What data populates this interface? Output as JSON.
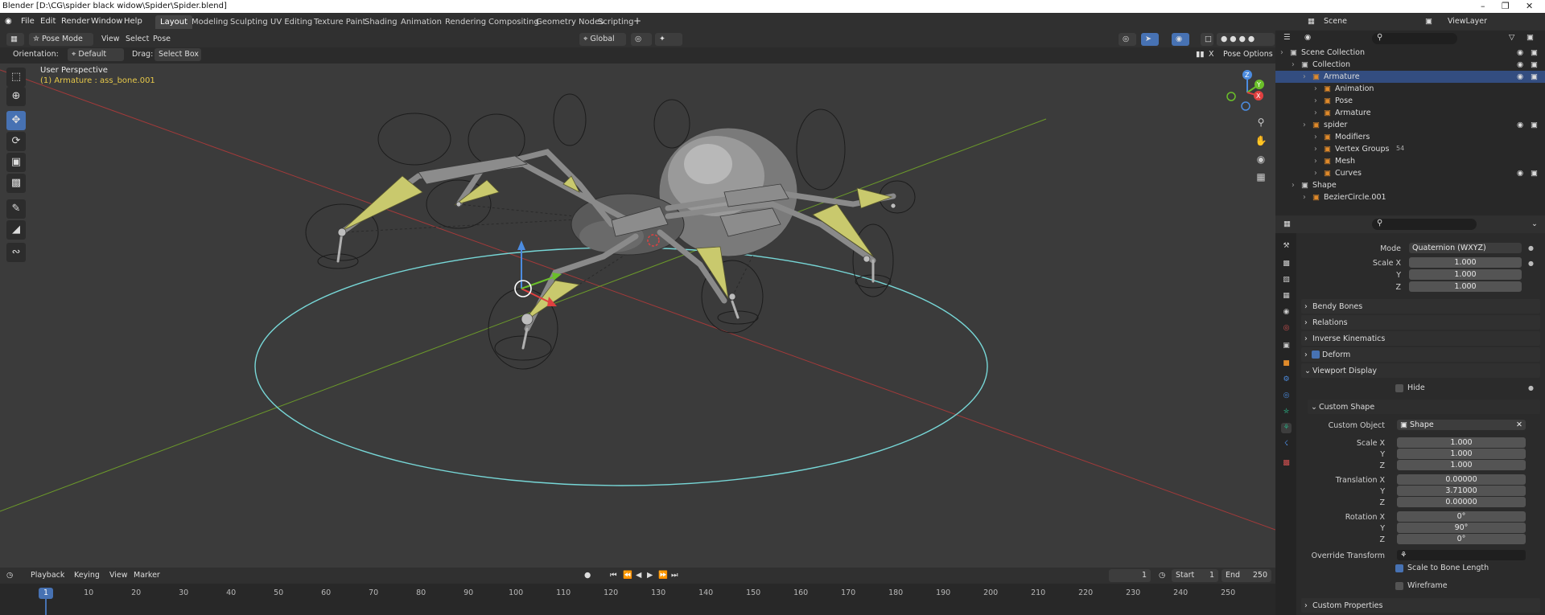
{
  "window": {
    "title": "Blender [D:\\CG\\spider black widow\\Spider\\Spider.blend]"
  },
  "menu": [
    "File",
    "Edit",
    "Render",
    "Window",
    "Help"
  ],
  "workspaces": [
    "Layout",
    "Modeling",
    "Sculpting",
    "UV Editing",
    "Texture Paint",
    "Shading",
    "Animation",
    "Rendering",
    "Compositing",
    "Geometry Nodes",
    "Scripting"
  ],
  "scene": {
    "name": "Scene",
    "view_layer": "ViewLayer"
  },
  "viewport_header": {
    "mode": "Pose Mode",
    "menus": [
      "View",
      "Select",
      "Pose"
    ],
    "transform_orientation": "Global",
    "orientation_label": "Orientation:",
    "orientation_value": "Default",
    "drag_label": "Drag:",
    "drag_value": "Select Box",
    "pose_options": "Pose Options"
  },
  "viewport": {
    "perspective": "User Perspective",
    "active_object": "(1) Armature : ass_bone.001",
    "gizmo_axes": [
      "X",
      "Y",
      "Z"
    ]
  },
  "timeline": {
    "menus": [
      "Playback",
      "Keying",
      "View",
      "Marker"
    ],
    "current_frame": "1",
    "start_label": "Start",
    "start": "1",
    "end_label": "End",
    "end": "250",
    "ticks": [
      "1",
      "10",
      "20",
      "30",
      "40",
      "50",
      "60",
      "70",
      "80",
      "90",
      "100",
      "110",
      "120",
      "130",
      "140",
      "150",
      "160",
      "170",
      "180",
      "190",
      "200",
      "210",
      "220",
      "230",
      "240",
      "250"
    ]
  },
  "outliner": {
    "items": [
      {
        "label": "Scene Collection",
        "indent": 0
      },
      {
        "label": "Collection",
        "indent": 1
      },
      {
        "label": "Armature",
        "indent": 2,
        "selected": true
      },
      {
        "label": "Animation",
        "indent": 3
      },
      {
        "label": "Pose",
        "indent": 3
      },
      {
        "label": "Armature",
        "indent": 3
      },
      {
        "label": "spider",
        "indent": 2
      },
      {
        "label": "Modifiers",
        "indent": 3
      },
      {
        "label": "Vertex Groups",
        "indent": 3
      },
      {
        "label": "Mesh",
        "indent": 3
      },
      {
        "label": "Curves",
        "indent": 3
      },
      {
        "label": "Shape",
        "indent": 1
      },
      {
        "label": "BezierCircle.001",
        "indent": 2
      }
    ],
    "vertex_groups_count": "54"
  },
  "properties": {
    "mode_label": "Mode",
    "mode_value": "Quaternion (WXYZ)",
    "scale": {
      "label_x": "Scale X",
      "x": "1.000",
      "y": "1.000",
      "z": "1.000"
    },
    "panels": {
      "bendy_bones": "Bendy Bones",
      "relations": "Relations",
      "inverse_kinematics": "Inverse Kinematics",
      "deform": "Deform",
      "viewport_display": "Viewport Display",
      "custom_shape": "Custom Shape",
      "custom_properties": "Custom Properties"
    },
    "hide_label": "Hide",
    "custom_object_label": "Custom Object",
    "custom_object_value": "Shape",
    "cs_scale": {
      "label_x": "Scale X",
      "x": "1.000",
      "y": "1.000",
      "z": "1.000"
    },
    "translation": {
      "label_x": "Translation X",
      "x": "0.00000",
      "y": "3.71000",
      "z": "0.00000"
    },
    "rotation": {
      "label_x": "Rotation X",
      "x": "0°",
      "y": "90°",
      "z": "0°"
    },
    "override_transform_label": "Override Transform",
    "scale_to_bone_length": "Scale to Bone Length",
    "wireframe": "Wireframe",
    "y_label": "Y",
    "z_label": "Z"
  },
  "colors": {
    "accent": "#4772b3",
    "selection": "#334d80",
    "bone_yellow": "#c8c86a",
    "circle_cyan": "#6ed0d0",
    "axis_red": "#b03a3a",
    "axis_green": "#6a9a2a"
  }
}
